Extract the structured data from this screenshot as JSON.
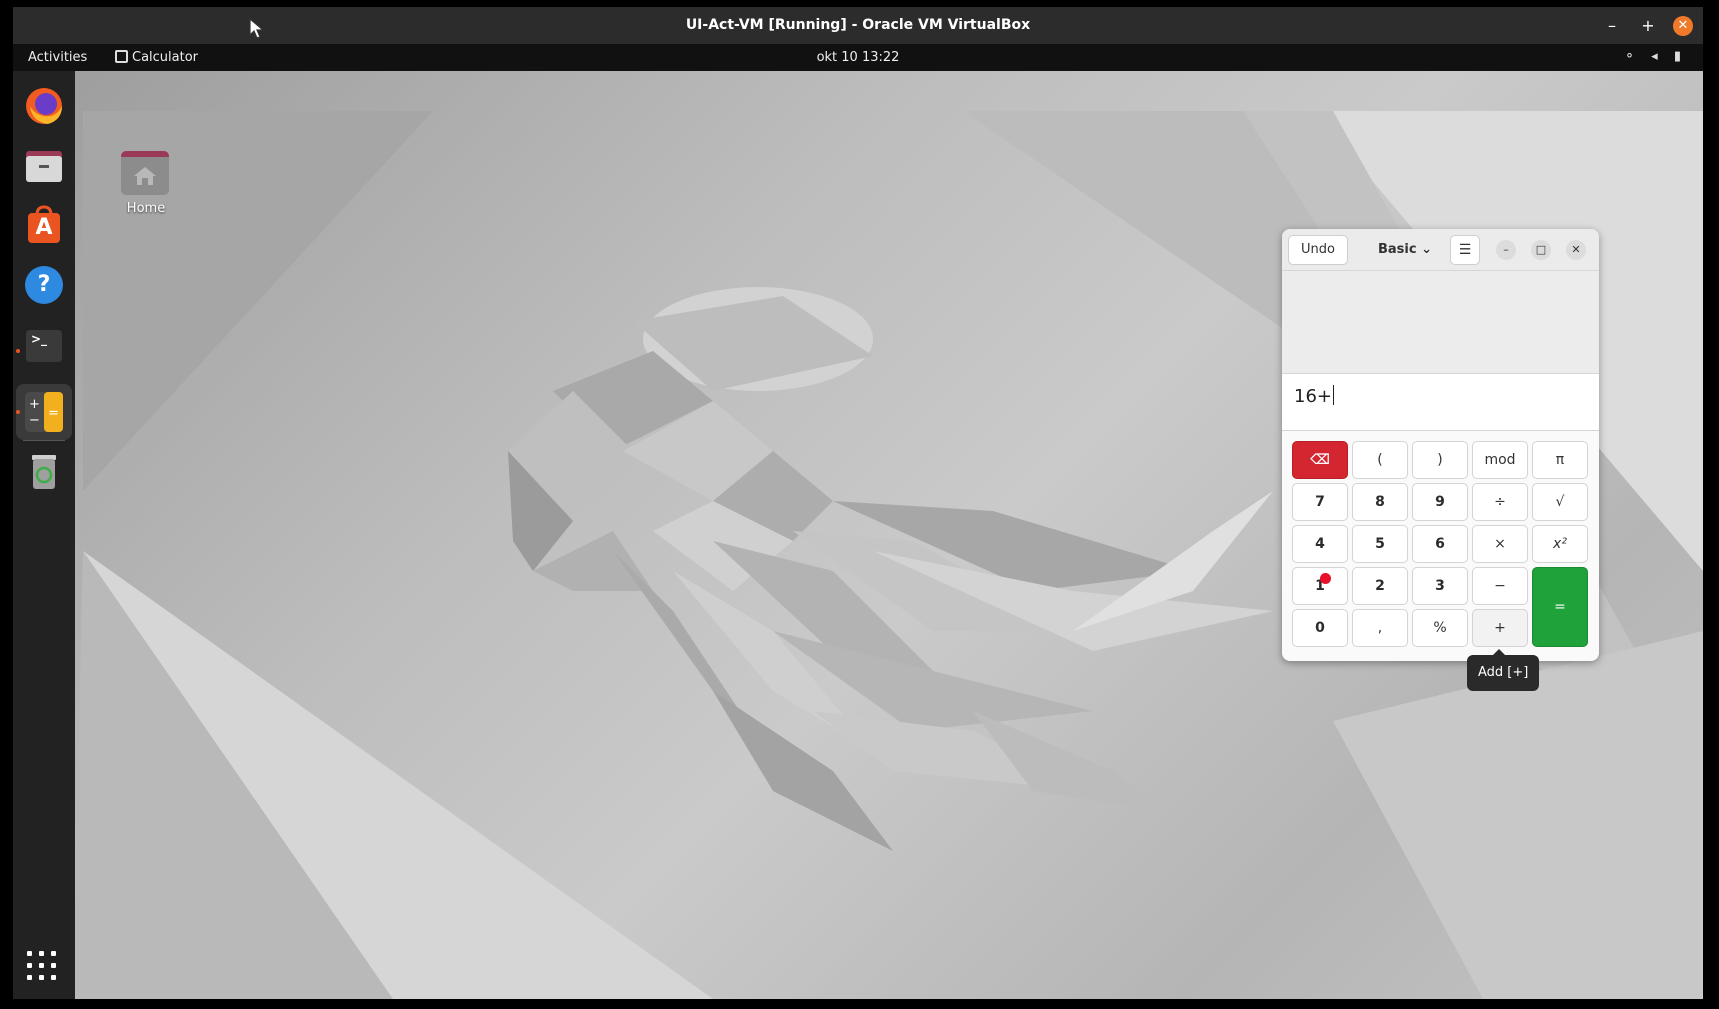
{
  "host": {
    "title": "UI-Act-VM [Running] - Oracle VM VirtualBox",
    "minimize_glyph": "–",
    "maximize_glyph": "+",
    "close_glyph": "✕"
  },
  "topbar": {
    "activities": "Activities",
    "app_name": "Calculator",
    "clock": "okt 10  13:22",
    "tray_icons": [
      "network-icon",
      "volume-icon",
      "battery-icon"
    ],
    "tray_glyphs": "⚬ ◂ ▮"
  },
  "dock": {
    "items": [
      {
        "name": "firefox-icon",
        "running": false
      },
      {
        "name": "files-icon",
        "running": false
      },
      {
        "name": "software-store-icon",
        "running": false
      },
      {
        "name": "help-icon",
        "running": false
      },
      {
        "name": "terminal-icon",
        "running": true
      },
      {
        "name": "calculator-icon",
        "running": true,
        "active": true
      },
      {
        "name": "trash-icon",
        "running": false
      }
    ],
    "help_glyph": "?",
    "terminal_glyph": ">_",
    "software_glyph": "A"
  },
  "desktop": {
    "home_label": "Home"
  },
  "calculator": {
    "undo_label": "Undo",
    "mode_label": "Basic",
    "mode_chevron": "⌄",
    "menu_glyph": "☰",
    "min_glyph": "–",
    "max_glyph": "□",
    "close_glyph": "✕",
    "entry": "16+",
    "keys": {
      "backspace": "⌫",
      "lparen": "(",
      "rparen": ")",
      "mod": "mod",
      "pi": "π",
      "k7": "7",
      "k8": "8",
      "k9": "9",
      "divide": "÷",
      "sqrt": "√",
      "k4": "4",
      "k5": "5",
      "k6": "6",
      "multiply": "×",
      "square": "x²",
      "k1": "1",
      "k2": "2",
      "k3": "3",
      "subtract": "−",
      "equals": "=",
      "k0": "0",
      "decimal": ",",
      "percent": "%",
      "add": "+"
    }
  },
  "tooltip": {
    "text": "Add [+]"
  },
  "colors": {
    "accent": "#e95420",
    "backspace": "#d42630",
    "equals": "#1fa23a",
    "close": "#f1792a"
  }
}
